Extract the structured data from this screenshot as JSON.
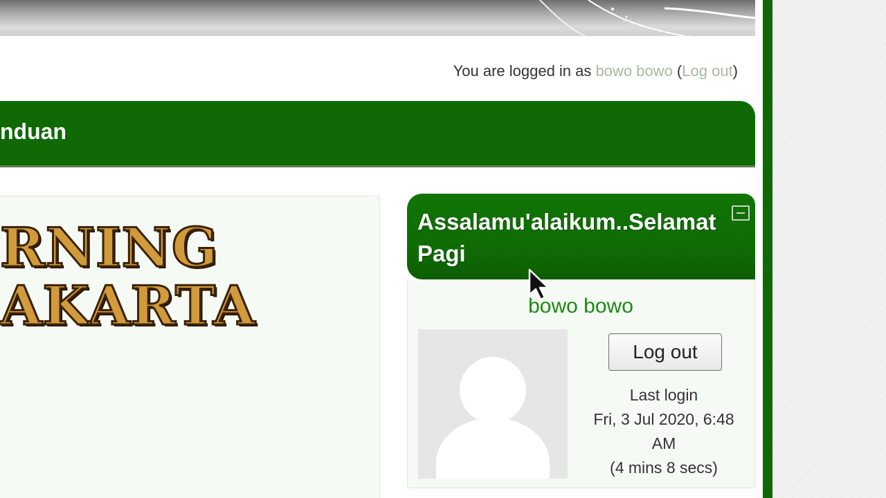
{
  "header": {
    "login_prefix": "You are logged in as ",
    "user_link": "bowo bowo",
    "open_paren": " (",
    "logout_link": "Log out",
    "close_paren": ")"
  },
  "navbar": {
    "title": "nduan"
  },
  "logo": {
    "line1": "RNING",
    "line2": "AKARTA"
  },
  "block": {
    "title": "Assalamu'alaikum..Selamat Pagi",
    "user_name": "bowo bowo",
    "logout_button": "Log out",
    "last_login_label": "Last login",
    "last_login_date": "Fri, 3 Jul 2020, 6:48",
    "last_login_time": "AM",
    "last_login_ago": "(4 mins 8 secs)"
  },
  "colors": {
    "brand_green": "#0f6a05",
    "link_muted": "#a9b89e",
    "user_link_green": "#1b8a10"
  },
  "icons": {
    "collapse": "minus-square-icon",
    "avatar": "default-user-avatar-icon",
    "cursor": "mouse-pointer-icon"
  }
}
